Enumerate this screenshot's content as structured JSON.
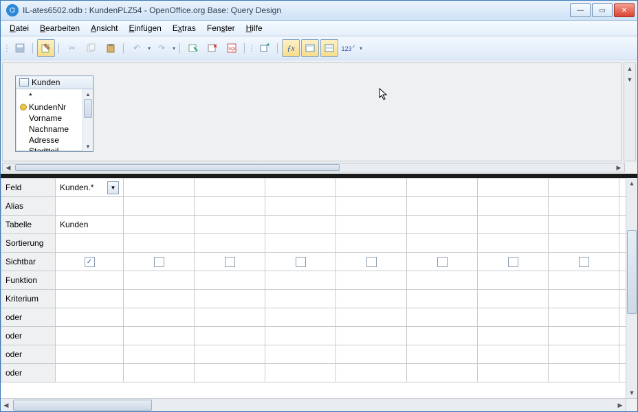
{
  "title": "IL-ates6502.odb : KundenPLZ54 - OpenOffice.org Base: Query Design",
  "menu": {
    "file": "Datei",
    "edit": "Bearbeiten",
    "view": "Ansicht",
    "insert": "Einfügen",
    "extras": "Extras",
    "window": "Fenster",
    "help": "Hilfe"
  },
  "table": {
    "name": "Kunden",
    "fields": [
      "*",
      "KundenNr",
      "Vorname",
      "Nachname",
      "Adresse",
      "Stadtteil"
    ],
    "pk_index": 1
  },
  "grid": {
    "row_labels": [
      "Feld",
      "Alias",
      "Tabelle",
      "Sortierung",
      "Sichtbar",
      "Funktion",
      "Kriterium",
      "oder",
      "oder",
      "oder",
      "oder"
    ],
    "columns": [
      {
        "field": "Kunden.*",
        "alias": "",
        "table": "Kunden",
        "sort": "",
        "visible": true,
        "func": "",
        "crit": "",
        "or": [
          "",
          "",
          "",
          ""
        ]
      },
      {
        "field": "",
        "alias": "",
        "table": "",
        "sort": "",
        "visible": false,
        "func": "",
        "crit": "",
        "or": [
          "",
          "",
          "",
          ""
        ]
      },
      {
        "field": "",
        "alias": "",
        "table": "",
        "sort": "",
        "visible": false,
        "func": "",
        "crit": "",
        "or": [
          "",
          "",
          "",
          ""
        ]
      },
      {
        "field": "",
        "alias": "",
        "table": "",
        "sort": "",
        "visible": false,
        "func": "",
        "crit": "",
        "or": [
          "",
          "",
          "",
          ""
        ]
      },
      {
        "field": "",
        "alias": "",
        "table": "",
        "sort": "",
        "visible": false,
        "func": "",
        "crit": "",
        "or": [
          "",
          "",
          "",
          ""
        ]
      },
      {
        "field": "",
        "alias": "",
        "table": "",
        "sort": "",
        "visible": false,
        "func": "",
        "crit": "",
        "or": [
          "",
          "",
          "",
          ""
        ]
      },
      {
        "field": "",
        "alias": "",
        "table": "",
        "sort": "",
        "visible": false,
        "func": "",
        "crit": "",
        "or": [
          "",
          "",
          "",
          ""
        ]
      },
      {
        "field": "",
        "alias": "",
        "table": "",
        "sort": "",
        "visible": false,
        "func": "",
        "crit": "",
        "or": [
          "",
          "",
          "",
          ""
        ]
      },
      {
        "field": "",
        "alias": "",
        "table": "",
        "sort": "",
        "visible": false,
        "func": "",
        "crit": "",
        "or": [
          "",
          "",
          "",
          ""
        ]
      }
    ]
  }
}
